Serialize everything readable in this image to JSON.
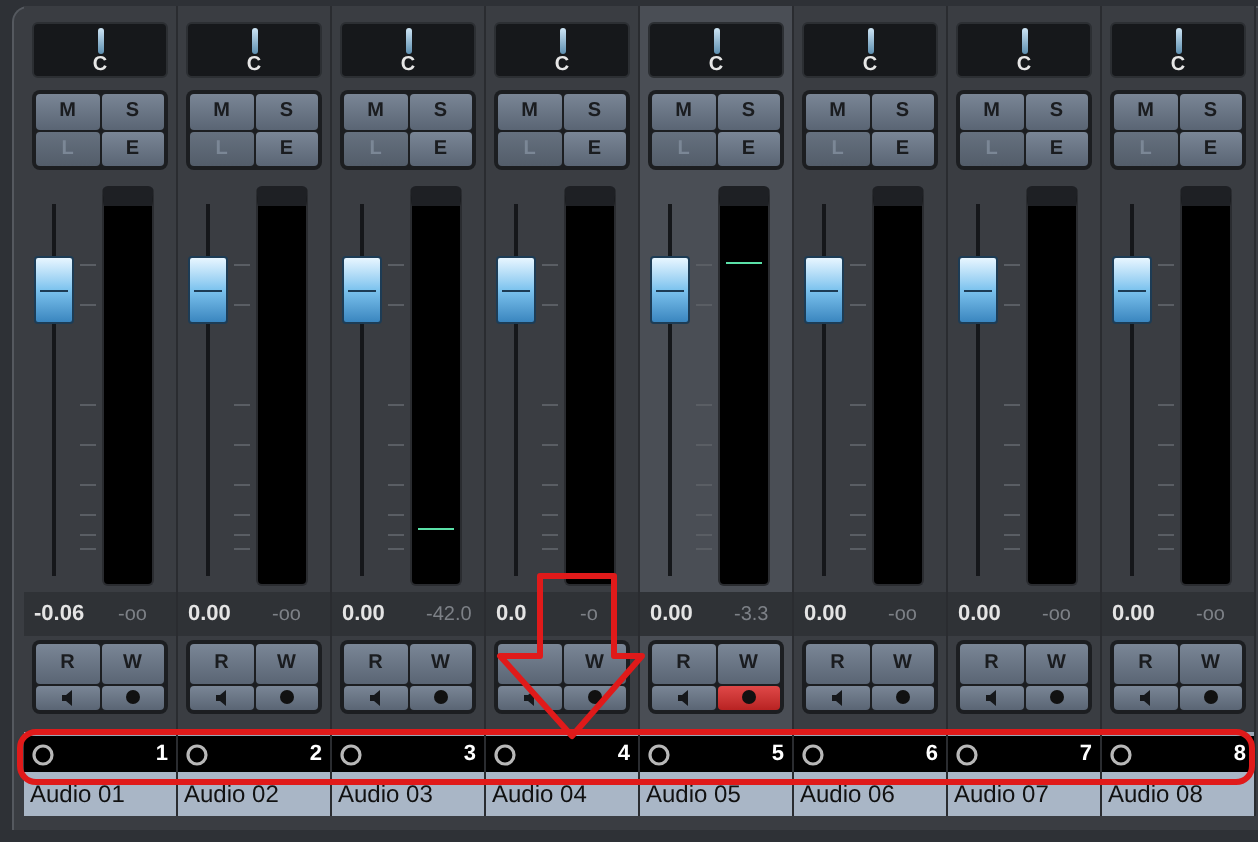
{
  "channels": [
    {
      "pan": "C",
      "mute": "M",
      "solo": "S",
      "listen": "L",
      "edit": "E",
      "volume": "-0.06",
      "peak": "-oo",
      "read": "R",
      "write": "W",
      "number": "1",
      "name": "Audio 01",
      "selected": false,
      "record": false
    },
    {
      "pan": "C",
      "mute": "M",
      "solo": "S",
      "listen": "L",
      "edit": "E",
      "volume": "0.00",
      "peak": "-oo",
      "read": "R",
      "write": "W",
      "number": "2",
      "name": "Audio 02",
      "selected": false,
      "record": false
    },
    {
      "pan": "C",
      "mute": "M",
      "solo": "S",
      "listen": "L",
      "edit": "E",
      "volume": "0.00",
      "peak": "-42.0",
      "read": "R",
      "write": "W",
      "number": "3",
      "name": "Audio 03",
      "selected": false,
      "record": false,
      "meter": {
        "level": 0.15
      }
    },
    {
      "pan": "C",
      "mute": "M",
      "solo": "S",
      "listen": "L",
      "edit": "E",
      "volume": "0.0",
      "peak": "-o",
      "write": "W",
      "number": "4",
      "name": "Audio 04",
      "selected": false,
      "record": false
    },
    {
      "pan": "C",
      "mute": "M",
      "solo": "S",
      "listen": "L",
      "edit": "E",
      "volume": "0.00",
      "peak": "-3.3",
      "read": "R",
      "write": "W",
      "number": "5",
      "name": "Audio 05",
      "selected": true,
      "record": true,
      "meter": {
        "level": 0.85
      }
    },
    {
      "pan": "C",
      "mute": "M",
      "solo": "S",
      "listen": "L",
      "edit": "E",
      "volume": "0.00",
      "peak": "-oo",
      "read": "R",
      "write": "W",
      "number": "6",
      "name": "Audio 06",
      "selected": false,
      "record": false
    },
    {
      "pan": "C",
      "mute": "M",
      "solo": "S",
      "listen": "L",
      "edit": "E",
      "volume": "0.00",
      "peak": "-oo",
      "read": "R",
      "write": "W",
      "number": "7",
      "name": "Audio 07",
      "selected": false,
      "record": false
    },
    {
      "pan": "C",
      "mute": "M",
      "solo": "S",
      "listen": "L",
      "edit": "E",
      "volume": "0.00",
      "peak": "-oo",
      "read": "R",
      "write": "W",
      "number": "8",
      "name": "Audio 08",
      "selected": false,
      "record": false
    }
  ]
}
